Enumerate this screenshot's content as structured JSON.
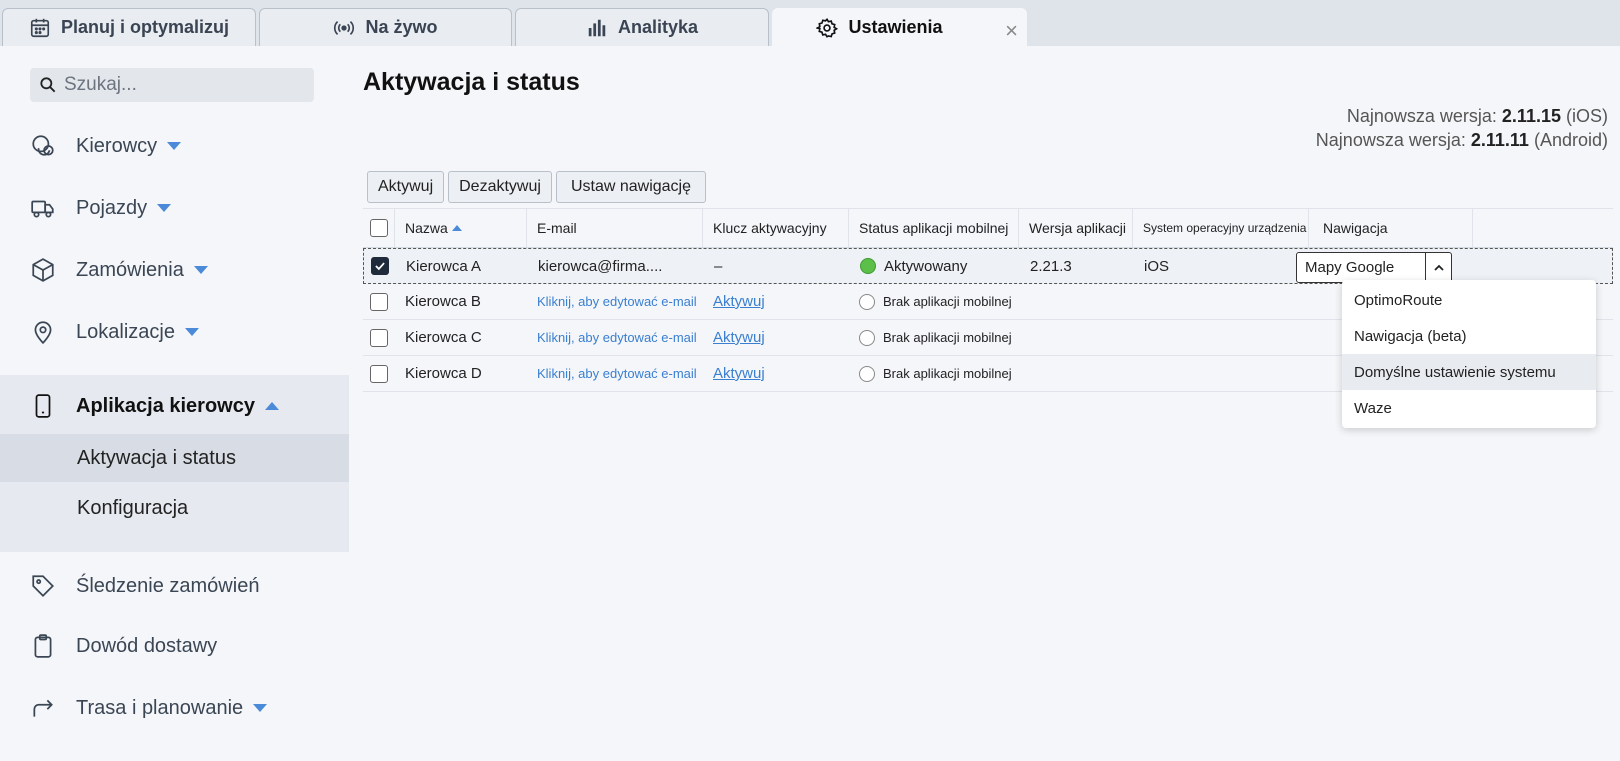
{
  "tabs": [
    {
      "label": "Planuj i optymalizuj",
      "icon": "calendar-icon"
    },
    {
      "label": "Na żywo",
      "icon": "broadcast-icon"
    },
    {
      "label": "Analityka",
      "icon": "bar-chart-icon"
    },
    {
      "label": "Ustawienia",
      "icon": "gear-icon",
      "active": true
    }
  ],
  "tab_close": "×",
  "search": {
    "placeholder": "Szukaj..."
  },
  "sidebar": {
    "items": [
      {
        "label": "Kierowcy",
        "icon": "drivers-icon"
      },
      {
        "label": "Pojazdy",
        "icon": "truck-icon"
      },
      {
        "label": "Zamówienia",
        "icon": "box-icon"
      },
      {
        "label": "Lokalizacje",
        "icon": "location-pin-icon"
      },
      {
        "label": "Aplikacja kierowcy",
        "icon": "phone-icon"
      },
      {
        "label": "Śledzenie zamówień",
        "icon": "tag-icon"
      },
      {
        "label": "Dowód dostawy",
        "icon": "clipboard-icon"
      },
      {
        "label": "Trasa i planowanie",
        "icon": "route-arrow-icon"
      }
    ],
    "sub_items": [
      {
        "label": "Aktywacja i status",
        "active": true
      },
      {
        "label": "Konfiguracja"
      }
    ]
  },
  "main": {
    "title": "Aktywacja i status",
    "versions": [
      {
        "prefix": "Najnowsza wersja:",
        "version": "2.11.15",
        "platform": "(iOS)"
      },
      {
        "prefix": "Najnowsza wersja:",
        "version": "2.11.11",
        "platform": "(Android)"
      }
    ],
    "buttons": {
      "activate": "Aktywuj",
      "deactivate": "Dezaktywuj",
      "set_nav": "Ustaw nawigację"
    },
    "table": {
      "headers": [
        "Nazwa",
        "E-mail",
        "Klucz aktywacyjny",
        "Status aplikacji mobilnej",
        "Wersja aplikacji",
        "System operacyjny urządzenia",
        "Nawigacja"
      ],
      "rows": [
        {
          "name": "Kierowca A",
          "email": "kierowca@firma....",
          "key": "–",
          "status": "Aktywowany",
          "version": "2.21.3",
          "os": "iOS",
          "nav": "Mapy Google"
        },
        {
          "name": "Kierowca B",
          "email": "Kliknij, aby edytować e-mail",
          "key": "Aktywuj",
          "status": "Brak aplikacji mobilnej",
          "version": "",
          "os": "",
          "nav": ""
        },
        {
          "name": "Kierowca C",
          "email": "Kliknij, aby edytować e-mail",
          "key": "Aktywuj",
          "status": "Brak aplikacji mobilnej",
          "version": "",
          "os": "",
          "nav": ""
        },
        {
          "name": "Kierowca D",
          "email": "Kliknij, aby edytować e-mail",
          "key": "Aktywuj",
          "status": "Brak aplikacji mobilnej",
          "version": "",
          "os": "",
          "nav": ""
        }
      ]
    },
    "nav_dropdown": {
      "selected": "Mapy Google",
      "options": [
        "OptimoRoute",
        "Nawigacja (beta)",
        "Domyślne ustawienie systemu",
        "Waze"
      ],
      "highlighted": "Domyślne ustawienie systemu"
    }
  },
  "colors": {
    "accent": "#4a8ad8",
    "status_green": "#5cbf4a",
    "link": "#3a7fd0"
  }
}
